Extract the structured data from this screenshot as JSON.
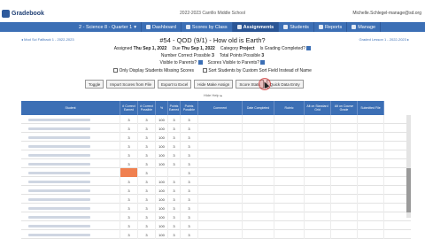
{
  "header": {
    "logo_text": "Gradebook",
    "school": "2022-2023 Carrillo Middle School",
    "user_email": "Michelle.Schlegel-manage@sd.org"
  },
  "nav": {
    "class_select": "2 - Science 8 - Quarter 1",
    "items": [
      {
        "label": "Dashboard",
        "icon": "dashboard-icon"
      },
      {
        "label": "Scores by Class",
        "icon": "scores-icon"
      },
      {
        "label": "Assignments",
        "icon": "assignments-icon"
      },
      {
        "label": "Students",
        "icon": "students-icon"
      },
      {
        "label": "Reports",
        "icon": "reports-icon"
      },
      {
        "label": "Manage",
        "icon": "gear-icon"
      }
    ]
  },
  "assignment": {
    "prev_link": "Mod Sci Fallback 1 - 2022-2023",
    "next_link": "Graded Lesson 1 - 2022-2023",
    "title": "#54 - QOD (9/1) - How old is Earth?",
    "assigned_label": "Assigned",
    "assigned_value": "Thu Sep 1, 2022",
    "due_label": "Due",
    "due_value": "Thu Sep 1, 2022",
    "category_label": "Category",
    "category_value": "Project",
    "graded_label": "Is Grading Completed?",
    "correct_label": "Number Correct Possible",
    "correct_value": "3",
    "points_label": "Total Points Possible",
    "points_value": "3",
    "visible_label": "Visible to Parents?",
    "scores_visible_label": "Scores Visible to Parents?",
    "missing_label": "Only Display Students Missing Scores",
    "sort_label": "Sort Students by Custom Sort Field Instead of Name"
  },
  "toolbar": {
    "buttons": [
      "Toggle",
      "Import Scores from File",
      "Export to Excel",
      "Hide Make Assign",
      "Score Stats",
      "Quick Data Entry"
    ],
    "hide_help": "Hide Help"
  },
  "grid": {
    "columns": [
      "Student",
      "# Correct Earned",
      "# Correct Possible",
      "%",
      "Points Earned",
      "Points Possible",
      "Comment",
      "Date Completed",
      "Rubric",
      "Alt on Standard Grid",
      "Alt on Course Grade",
      "Submitted File"
    ],
    "rows": [
      [
        "",
        "3",
        "3",
        "100",
        "3",
        "3"
      ],
      [
        "",
        "3",
        "3",
        "100",
        "3",
        "3"
      ],
      [
        "",
        "3",
        "3",
        "100",
        "3",
        "3"
      ],
      [
        "",
        "3",
        "3",
        "100",
        "3",
        "3"
      ],
      [
        "",
        "3",
        "3",
        "100",
        "3",
        "3"
      ],
      [
        "",
        "3",
        "3",
        "100",
        "3",
        "3"
      ],
      [
        "",
        "",
        "3",
        "",
        "",
        "3"
      ],
      [
        "",
        "3",
        "3",
        "100",
        "3",
        "3"
      ],
      [
        "",
        "3",
        "3",
        "100",
        "3",
        "3"
      ],
      [
        "",
        "3",
        "3",
        "100",
        "3",
        "3"
      ],
      [
        "",
        "3",
        "3",
        "100",
        "3",
        "3"
      ],
      [
        "",
        "3",
        "3",
        "100",
        "3",
        "3"
      ],
      [
        "",
        "3",
        "3",
        "100",
        "3",
        "3"
      ],
      [
        "",
        "3",
        "3",
        "100",
        "3",
        "3"
      ]
    ],
    "missing_color": "#f08050"
  },
  "colors": {
    "nav_bg": "#3c6fb5",
    "header_bg": "#3c6fb5"
  }
}
